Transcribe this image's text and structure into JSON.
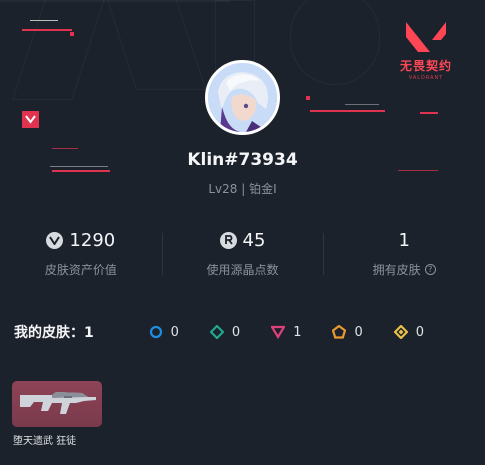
{
  "brand": {
    "name": "无畏契约",
    "sub": "VALORANT"
  },
  "player": {
    "name": "Klin#73934",
    "rank": "Lv28 | 铂金I"
  },
  "stats": [
    {
      "icon": "valorant-points-icon",
      "value": "1290",
      "label": "皮肤资产价值"
    },
    {
      "icon": "radianite-icon",
      "value": "45",
      "label": "使用源晶点数"
    },
    {
      "icon": null,
      "value": "1",
      "label": "拥有皮肤"
    }
  ],
  "skins": {
    "title": "我的皮肤：1",
    "tiers": [
      {
        "icon": "tier-circle-icon",
        "color": "#1e8fe0",
        "count": "0"
      },
      {
        "icon": "tier-diamond-icon",
        "color": "#1fa88f",
        "count": "0"
      },
      {
        "icon": "tier-triangle-icon",
        "color": "#e0407a",
        "count": "1"
      },
      {
        "icon": "tier-pentagon-icon",
        "color": "#e89a2f",
        "count": "0"
      },
      {
        "icon": "tier-rhombus-icon",
        "color": "#e8c04a",
        "count": "0"
      }
    ],
    "items": [
      {
        "name": "堕天遗武 狂徒"
      }
    ]
  },
  "colors": {
    "accent": "#e0334f",
    "background": "#1c222b"
  }
}
